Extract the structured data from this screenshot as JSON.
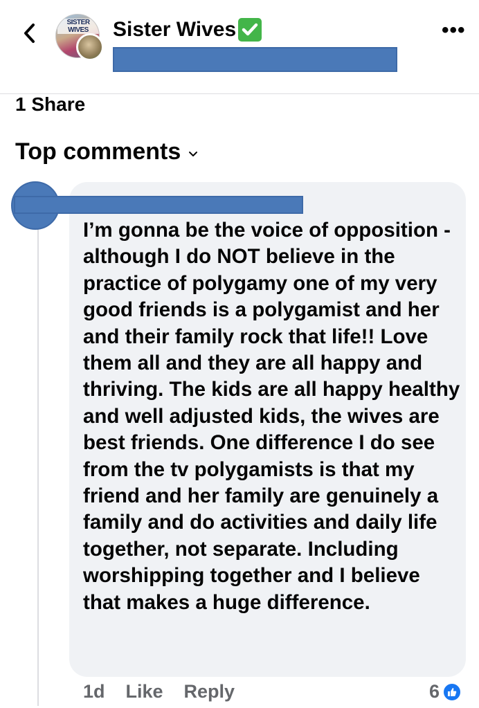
{
  "header": {
    "page_name": "Sister Wives",
    "avatar_logo_text": "SISTER WIVES",
    "more_label": "•••"
  },
  "post": {
    "share_count": "1 Share"
  },
  "comments_section": {
    "title": "Top comments"
  },
  "comment": {
    "text": "I’m gonna be the voice of opposition - although I do NOT believe in the practice of polygamy one of my very good friends is a polygamist and her and their family rock that life!! Love them all and they are all happy and thriving. The kids are all happy healthy and well adjusted kids, the wives are best friends. One difference I do see from the tv polygamists is that my friend and her family are genuinely a family and do activities and daily life together, not separate. Including worshipping together and I believe that makes a huge difference.",
    "time": "1d",
    "like_label": "Like",
    "reply_label": "Reply",
    "reaction_count": "6"
  },
  "colors": {
    "redaction": "#4a79b8",
    "verified": "#43b549",
    "like": "#1877f2",
    "bubble": "#f0f2f5"
  }
}
